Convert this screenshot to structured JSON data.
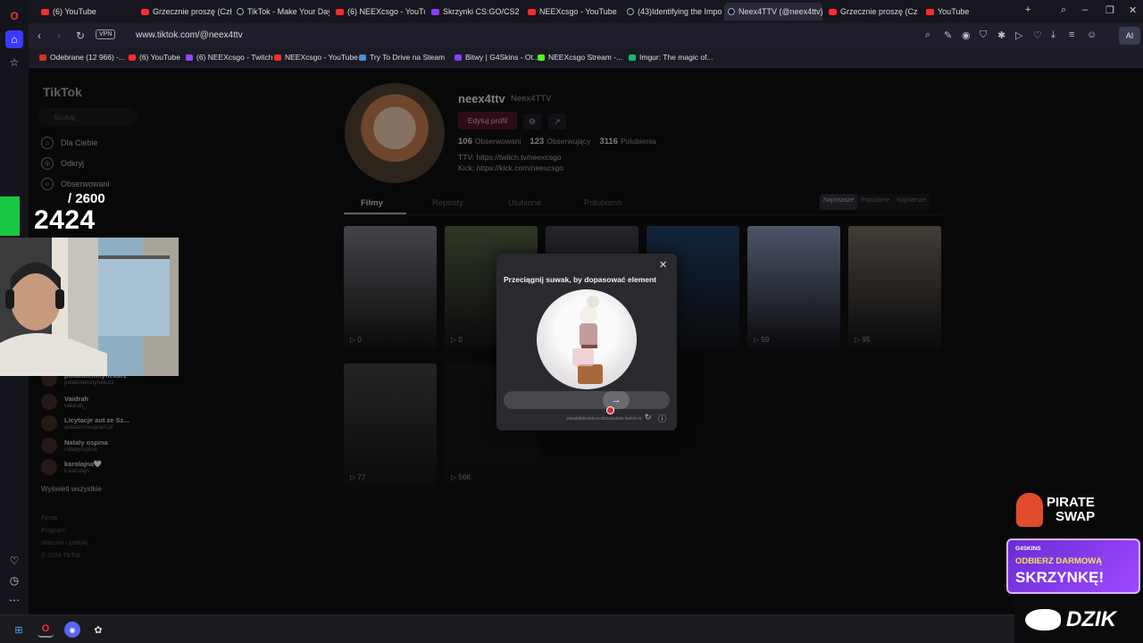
{
  "browser": {
    "tabs": [
      {
        "label": "(6) YouTube",
        "icon": "youtube-icon"
      },
      {
        "label": "Grzecznie proszę (Człuch",
        "icon": "youtube-icon"
      },
      {
        "label": "TikTok - Make Your Day",
        "icon": "tiktok-icon"
      },
      {
        "label": "(6) NEEXcsgo - YouTube",
        "icon": "youtube-icon"
      },
      {
        "label": "Skrzynki CS:GO/CS2 | G4",
        "icon": "g4skins-icon"
      },
      {
        "label": "NEEXcsgo - YouTube",
        "icon": "youtube-icon"
      },
      {
        "label": "(43)Identifying the Impo",
        "icon": "tiktok-icon"
      },
      {
        "label": "Neex4TTV (@neex4ttv) | T",
        "icon": "tiktok-icon"
      },
      {
        "label": "Grzecznie proszę (Człuch",
        "icon": "youtube-icon"
      },
      {
        "label": "YouTube",
        "icon": "youtube-icon"
      }
    ],
    "url": "www.tiktok.com/@neex4ttv",
    "vpn_label": "VPN",
    "ai_label": "AI",
    "bookmarks": [
      {
        "label": "Odebrane (12 966) -...",
        "color": "#d93025"
      },
      {
        "label": "(6) YouTube",
        "color": "#ff2b2b"
      },
      {
        "label": "(6) NEEXcsgo - Twitch",
        "color": "#9146ff"
      },
      {
        "label": "NEEXcsgo - YouTube",
        "color": "#ff2b2b"
      },
      {
        "label": "Try To Drive na Steam",
        "color": "#4a90c8"
      },
      {
        "label": "Bitwy | G4Skins - Ot...",
        "color": "#8a3cff"
      },
      {
        "label": "NEEXcsgo Stream -...",
        "color": "#53fc18"
      },
      {
        "label": "Imgur: The magic of...",
        "color": "#1bb76e"
      }
    ]
  },
  "tiktok": {
    "logo": "TikTok",
    "search_placeholder": "Szukaj",
    "nav": [
      {
        "label": "Dla Ciebie",
        "icon": "home-icon"
      },
      {
        "label": "Odkryj",
        "icon": "compass-icon"
      },
      {
        "label": "Obserwowani",
        "icon": "following-icon"
      }
    ],
    "following_accounts": [
      {
        "name": "polakolemnynekurz",
        "user": "polakolemnynekurz"
      },
      {
        "name": "Vaidrah",
        "user": "vaidrah_"
      },
      {
        "name": "Licytacje aut ze Sz...",
        "user": "autazeszwajcarii.pl"
      },
      {
        "name": "Nataly ospina",
        "user": "natalyospina"
      },
      {
        "name": "karolajna🤍",
        "user": "k.karolajn"
      }
    ],
    "show_all": "Wyświetl wszystkie",
    "footer": [
      "Firma",
      "Program",
      "Warunki i polityki",
      "© 2024 TikTok"
    ],
    "profile": {
      "username": "neex4ttv",
      "display_name": "Neex4TTV",
      "edit_button": "Edytuj profil",
      "following_count": "106",
      "following_label": "Obserwowani",
      "followers_count": "123",
      "followers_label": "Obserwujący",
      "likes_count": "3116",
      "likes_label": "Polubienia",
      "bio_line1": "TTV: https://twitch.tv/neexcsgo",
      "bio_line2": "Kick: https://kick.com/neexcsgo"
    },
    "tabs": [
      "Filmy",
      "Reposty",
      "Ulubione",
      "Polubiono"
    ],
    "sort_options": [
      "Najnowsze",
      "Popularne",
      "Najstarsze"
    ],
    "videos": [
      {
        "views": "0",
        "color": "#6b6e73"
      },
      {
        "views": "0",
        "color": "#4d5a3e"
      },
      {
        "views": "",
        "color": "#3a3d44"
      },
      {
        "views": "",
        "color": "#1e3a5c"
      },
      {
        "views": "59",
        "color": "#7a8aa6"
      },
      {
        "views": "95",
        "color": "#6c6258"
      },
      {
        "views": "77",
        "color": "#3d3a38"
      },
      {
        "views": "56K",
        "color": "#141418"
      }
    ]
  },
  "captcha": {
    "title": "Przeciągnij suwak, by dopasować element",
    "slider_icon": "arrow-right-icon",
    "id_text": "2956d6f5f04f9bc0c3f30ad4d094 f8bf0f175"
  },
  "overlay": {
    "sub_goal": "2600",
    "sub_goal_separator": "/",
    "sub_count": "2424",
    "pirate_line1": "PIRATE",
    "pirate_line2": "SWAP",
    "promo_brand": "G4SKINS",
    "promo_line1": "ODBIERZ DARMOWĄ",
    "promo_line2": "SKRZYNKĘ!",
    "dzik": "DZIK"
  }
}
